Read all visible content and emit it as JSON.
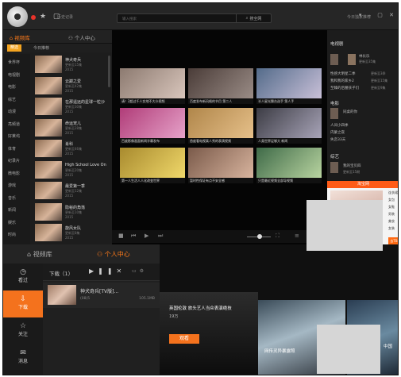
{
  "search": {
    "placeholder": "输入搜索",
    "button": "搜全网"
  },
  "topbar": {
    "link": "历史记录",
    "right_label": "今日独家推荐"
  },
  "upper_tabs": [
    {
      "label": "视频库"
    },
    {
      "label": "个人中心"
    }
  ],
  "subnav": [
    {
      "label": "精选"
    },
    {
      "label": "今日推荐"
    }
  ],
  "categories": [
    "世界杯",
    "电视剧",
    "电影",
    "综艺",
    "动漫",
    "亮频道",
    "好莱坞",
    "体育",
    "纪录片",
    "微电影",
    "游戏",
    "音乐",
    "新闻",
    "娱乐",
    "时尚"
  ],
  "video_list": [
    {
      "title": "神犬奇兵",
      "sub": "更新至15集",
      "sub2": "2015"
    },
    {
      "title": "云巅之爱",
      "sub": "更新至42集",
      "sub2": "2015"
    },
    {
      "title": "在那遥远的星球一粒沙",
      "sub": "更新至30集",
      "sub2": "2015"
    },
    {
      "title": "命运宠儿",
      "sub": "更新至28集",
      "sub2": "2015"
    },
    {
      "title": "肖科",
      "sub": "更新至46集",
      "sub2": "2015"
    },
    {
      "title": "High School Love On",
      "sub": "更新至20集",
      "sub2": "2015"
    },
    {
      "title": "最爱第一季",
      "sub": "更新至12集",
      "sub2": "2015"
    },
    {
      "title": "隐秘的角落",
      "sub": "更新至10集",
      "sub2": "2015"
    },
    {
      "title": "旋风女队",
      "sub": "更新至8集",
      "sub2": "2015"
    }
  ],
  "grid": [
    {
      "caption": "请！2超过千人实地不大众视频",
      "colors": [
        "#8c7a70",
        "#d9c6bc"
      ]
    },
    {
      "caption": "百度发布新风格的节目 第二人",
      "colors": [
        "#4a3c38",
        "#9a8c86"
      ]
    },
    {
      "caption": "半人星光舞台选手 第人手",
      "colors": [
        "#536b8a",
        "#c9c0d8"
      ]
    },
    {
      "caption": "百度影像画面新闻字幕发布",
      "colors": [
        "#b03c78",
        "#e6a2c9"
      ]
    },
    {
      "caption": "首度看电视真人秀的表演视频",
      "colors": [
        "#b0864a",
        "#e6c08a"
      ]
    },
    {
      "caption": "人类世界足够大 新闻",
      "colors": [
        "#3c3c44",
        "#a8a4b8"
      ]
    },
    {
      "caption": "第一人生活人人化改变世界",
      "colors": [
        "#a88a2e",
        "#f0d86a"
      ]
    },
    {
      "caption": "暂时性保证有点不安全感",
      "colors": [
        "#7a5a4a",
        "#d8b49e"
      ]
    },
    {
      "caption": "只是最近视频全部导视频",
      "colors": [
        "#3f6a48",
        "#b8d4a0"
      ]
    }
  ],
  "right_panel": {
    "tv_heading": "电视剧",
    "tv_items": [
      {
        "name": "林长乐",
        "meta": "更新至35集"
      },
      {
        "name": "性感大明星二季",
        "meta": "更新至3季"
      },
      {
        "name": "我和我的家乡2",
        "meta": "更新至15集"
      },
      {
        "name": "至臻的后腰孩子们",
        "meta": "更新至9集"
      }
    ],
    "movie_heading": "电影",
    "movie_items": [
      {
        "name": "同桌的你",
        "meta": "2015"
      },
      {
        "name": "人间小四季",
        "meta": "2015"
      },
      {
        "name": "内蒙之夜",
        "meta": "2015"
      },
      {
        "name": "失恋33天",
        "meta": "2015"
      }
    ],
    "variety_heading": "综艺",
    "variety_items": [
      {
        "name": "我的宝贝四",
        "meta": "更新至15期"
      }
    ],
    "ad_heading": "淘宝网",
    "ad_side": [
      "连衣裙",
      "女包",
      "女鞋",
      "男装",
      "美妆",
      "女装"
    ],
    "ad_button": "去TB"
  },
  "lower_tabs": [
    {
      "label": "视频库"
    },
    {
      "label": "个人中心"
    }
  ],
  "lower_nav": [
    {
      "label": "看过",
      "icon": "clock"
    },
    {
      "label": "下载",
      "icon": "download"
    },
    {
      "label": "关注",
      "icon": "star"
    },
    {
      "label": "消息",
      "icon": "message"
    }
  ],
  "downloads": {
    "title": "下载（1）",
    "item": {
      "name": "神犬奇兵[TV版]...",
      "meta": "(08)5",
      "size": "105.1MB"
    }
  },
  "promo": {
    "caption1": "英国伦敦 旅头艺人当众表演绝技",
    "meta": "19万",
    "caption2": "网传灵异暴露照",
    "button": "观看",
    "caption3": "中国"
  }
}
